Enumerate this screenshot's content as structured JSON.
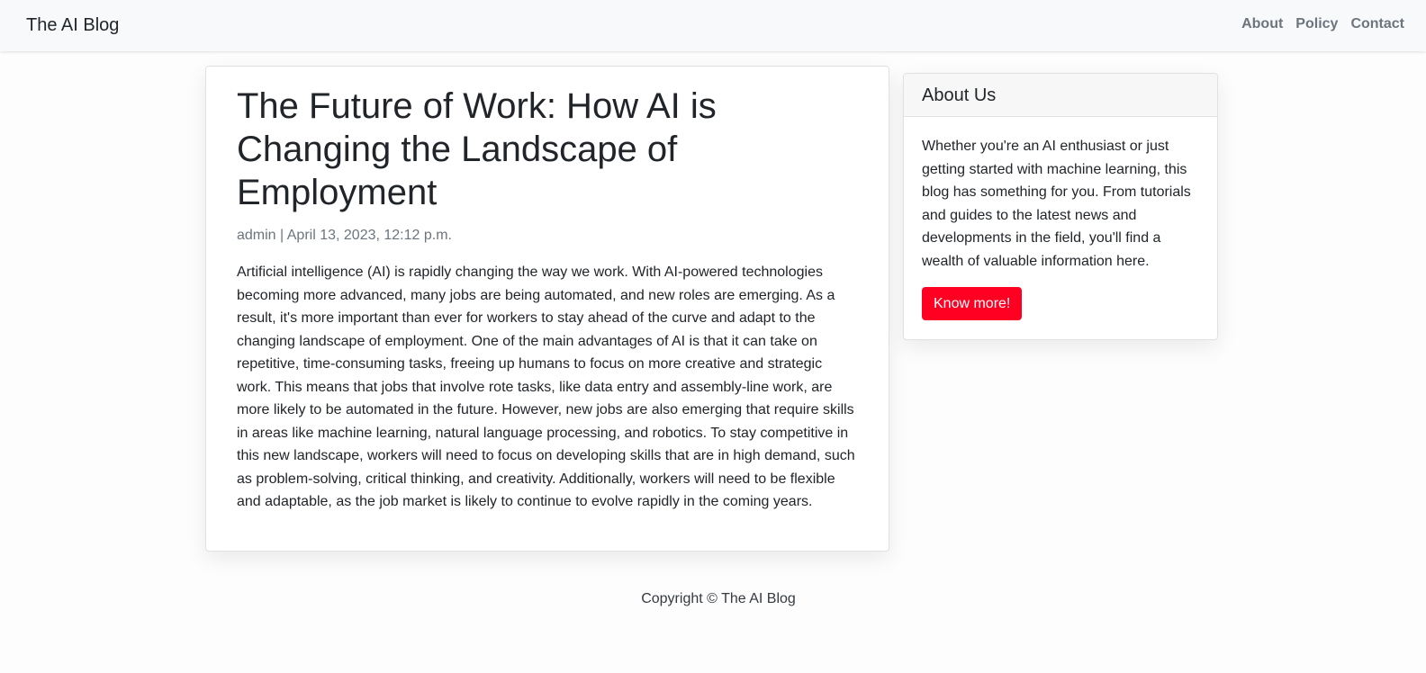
{
  "navbar": {
    "brand": "The AI Blog",
    "links": [
      {
        "label": "About"
      },
      {
        "label": "Policy"
      },
      {
        "label": "Contact"
      }
    ]
  },
  "post": {
    "title": "The Future of Work: How AI is Changing the Landscape of Employment",
    "author": "admin",
    "separator": "|",
    "date": "April 13, 2023, 12:12 p.m.",
    "body": "Artificial intelligence (AI) is rapidly changing the way we work. With AI-powered technologies becoming more advanced, many jobs are being automated, and new roles are emerging. As a result, it's more important than ever for workers to stay ahead of the curve and adapt to the changing landscape of employment. One of the main advantages of AI is that it can take on repetitive, time-consuming tasks, freeing up humans to focus on more creative and strategic work. This means that jobs that involve rote tasks, like data entry and assembly-line work, are more likely to be automated in the future. However, new jobs are also emerging that require skills in areas like machine learning, natural language processing, and robotics. To stay competitive in this new landscape, workers will need to focus on developing skills that are in high demand, such as problem-solving, critical thinking, and creativity. Additionally, workers will need to be flexible and adaptable, as the job market is likely to continue to evolve rapidly in the coming years."
  },
  "sidebar": {
    "title": "About Us",
    "text": "Whether you're an AI enthusiast or just getting started with machine learning, this blog has something for you. From tutorials and guides to the latest news and developments in the field, you'll find a wealth of valuable information here.",
    "button_label": "Know more!"
  },
  "footer": {
    "text": "Copyright © The AI Blog"
  },
  "colors": {
    "accent_button": "#ff0023",
    "navbar_bg": "#f8f9fa",
    "muted_text": "#6c757d"
  }
}
